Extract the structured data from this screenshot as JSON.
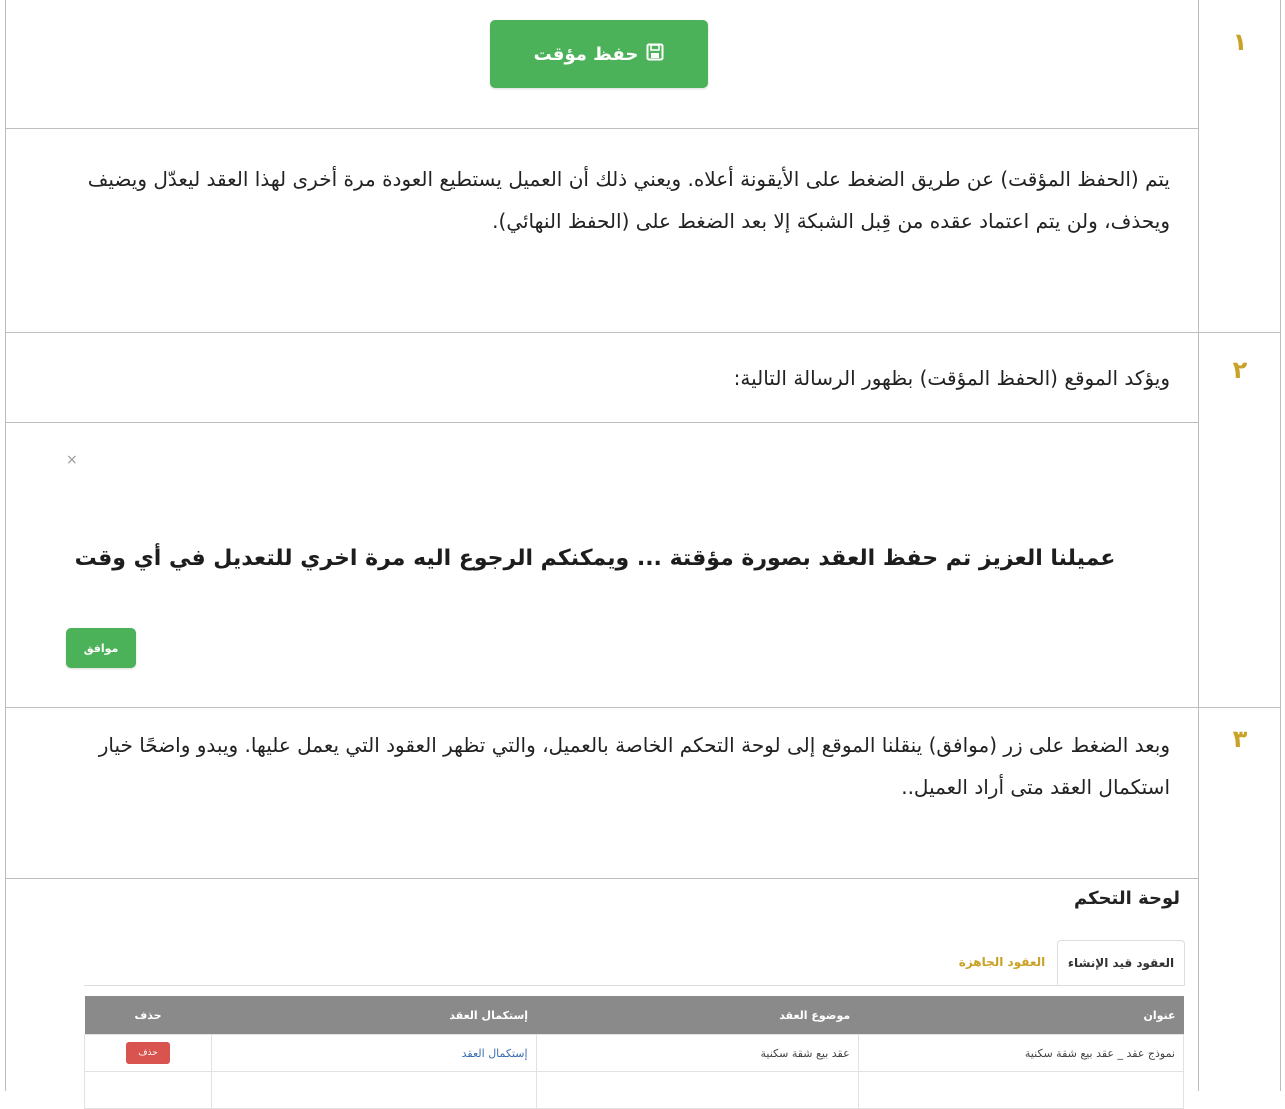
{
  "step_numbers": [
    "١",
    "٢",
    "٣"
  ],
  "step1": {
    "save_button_label": "حفظ مؤقت",
    "save_icon": "floppy-disk-icon",
    "paragraph": "يتم (الحفظ المؤقت) عن طريق الضغط على الأيقونة أعلاه. ويعني ذلك أن العميل يستطيع العودة مرة أخرى لهذا العقد ليعدّل ويضيف ويحذف، ولن يتم اعتماد عقده من قِبل الشبكة إلا بعد الضغط على (الحفظ النهائي)."
  },
  "step2": {
    "paragraph": "ويؤكد الموقع (الحفظ المؤقت) بظهور الرسالة التالية:",
    "modal": {
      "close_symbol": "×",
      "message": "عميلنا العزيز تم حفظ العقد بصورة مؤقتة ... ويمكنكم الرجوع اليه مرة اخري للتعديل في أي وقت",
      "ok_label": "موافق"
    }
  },
  "step3": {
    "paragraph": "وبعد الضغط على زر (موافق) ينقلنا الموقع إلى لوحة التحكم الخاصة بالعميل، والتي تظهر العقود التي يعمل عليها. ويبدو واضحًا خيار استكمال العقد متى أراد العميل..",
    "dashboard": {
      "title": "لوحة التحكم",
      "tabs": [
        "العقود قيد الإنشاء",
        "العقود الجاهزة"
      ],
      "columns": [
        "عنوان",
        "موضوع العقد",
        "إستكمال العقد",
        "حذف"
      ],
      "rows": [
        {
          "title": "نموذج عقد _ عقد بيع شقة سكنية",
          "subject": "عقد بيع شقة سكنية",
          "complete_link": "إستكمال العقد",
          "delete_label": "حذف"
        }
      ]
    }
  },
  "colors": {
    "accent_green": "#4cb25a",
    "step_number": "#c9a227",
    "table_header": "#8a8a8a",
    "delete_red": "#d9534f"
  }
}
